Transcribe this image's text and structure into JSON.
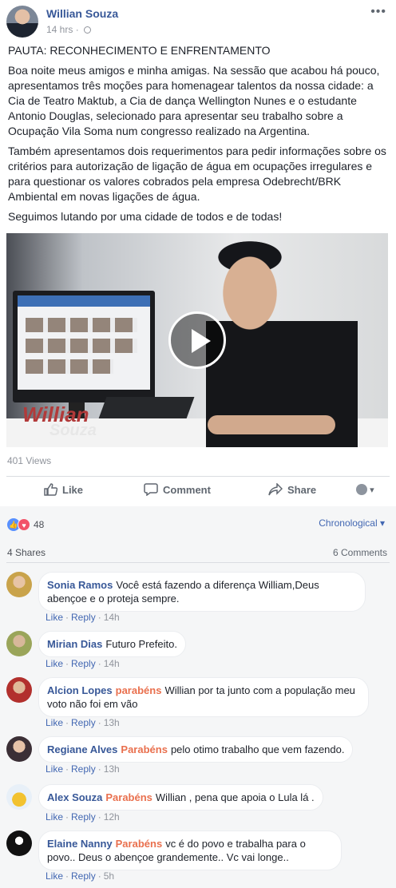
{
  "post": {
    "author": "Willian Souza",
    "time": "14 hrs",
    "more": "•••",
    "paragraphs": [
      "PAUTA: RECONHECIMENTO E ENFRENTAMENTO",
      "Boa noite meus amigos e minha amigas. Na sessão que acabou há pouco, apresentamos três moções para homenagear talentos da nossa cidade: a Cia de Teatro Maktub, a Cia de dança Wellington Nunes e o estudante Antonio Douglas, selecionado para apresentar seu trabalho sobre a Ocupação Vila Soma num congresso realizado na Argentina.",
      "Também apresentamos dois requerimentos para pedir informações sobre os critérios para autorização de ligação de água em ocupações irregulares e para questionar os valores cobrados pela empresa Odebrecht/BRK Ambiental em novas ligações de água.",
      "Seguimos lutando por uma cidade de todos e de todas!"
    ],
    "video_watermark": "Willian",
    "video_watermark2": "Souza",
    "views": "401 Views"
  },
  "actions": {
    "like": "Like",
    "comment": "Comment",
    "share": "Share",
    "audience_caret": "▾"
  },
  "reactions": {
    "count": "48",
    "sort": "Chronological ▾",
    "shares": "4 Shares",
    "comments": "6 Comments"
  },
  "comments": [
    {
      "name": "Sonia Ramos",
      "tag": "",
      "text": "Você está fazendo a diferença William,Deus abençoe e o proteja sempre.",
      "like": "Like",
      "reply": "Reply",
      "time": "14h"
    },
    {
      "name": "Mirian Dias",
      "tag": "",
      "text": "Futuro Prefeito.",
      "like": "Like",
      "reply": "Reply",
      "time": "14h"
    },
    {
      "name": "Alcion Lopes",
      "tag": "parabéns",
      "text": "Willian por ta junto com a população meu voto não foi em vão",
      "like": "Like",
      "reply": "Reply",
      "time": "13h"
    },
    {
      "name": "Regiane Alves",
      "tag": "Parabéns",
      "text": "pelo otimo trabalho que vem fazendo.",
      "like": "Like",
      "reply": "Reply",
      "time": "13h"
    },
    {
      "name": "Alex Souza",
      "tag": "Parabéns",
      "text": "Willian , pena que apoia o Lula lá .",
      "like": "Like",
      "reply": "Reply",
      "time": "12h"
    },
    {
      "name": "Elaine Nanny",
      "tag": "Parabéns",
      "text": "vc é do povo e trabalha para o povo.. Deus o abençoe grandemente.. Vc vai longe..",
      "like": "Like",
      "reply": "Reply",
      "time": "5h"
    }
  ]
}
